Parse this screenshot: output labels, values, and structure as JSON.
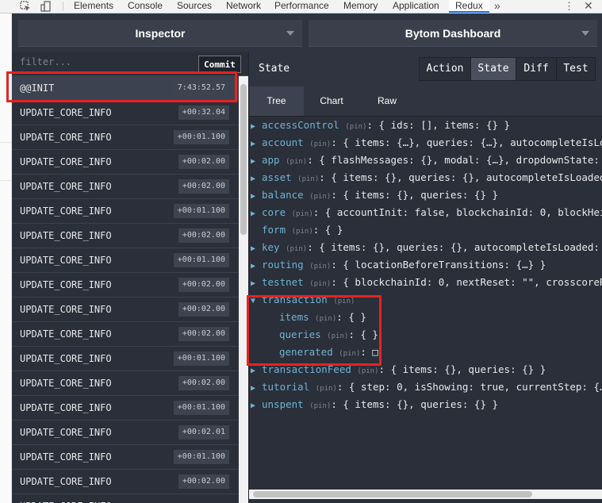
{
  "devtools": {
    "tabs": [
      "Elements",
      "Console",
      "Sources",
      "Network",
      "Performance",
      "Memory",
      "Application",
      "Redux"
    ],
    "active_tab": "Redux",
    "more_label": "»",
    "menu_label": "⋮",
    "close_label": "✕"
  },
  "monitor": {
    "left_select": "Inspector",
    "right_select": "Bytom Dashboard"
  },
  "actions": {
    "filter_placeholder": "filter...",
    "commit_label": "Commit",
    "items": [
      {
        "name": "@@INIT",
        "time": "7:43:52.57"
      },
      {
        "name": "UPDATE_CORE_INFO",
        "time": "+00:32.04"
      },
      {
        "name": "UPDATE_CORE_INFO",
        "time": "+00:01.100"
      },
      {
        "name": "UPDATE_CORE_INFO",
        "time": "+00:02.00"
      },
      {
        "name": "UPDATE_CORE_INFO",
        "time": "+00:02.00"
      },
      {
        "name": "UPDATE_CORE_INFO",
        "time": "+00:01.100"
      },
      {
        "name": "UPDATE_CORE_INFO",
        "time": "+00:02.00"
      },
      {
        "name": "UPDATE_CORE_INFO",
        "time": "+00:01.100"
      },
      {
        "name": "UPDATE_CORE_INFO",
        "time": "+00:02.00"
      },
      {
        "name": "UPDATE_CORE_INFO",
        "time": "+00:02.00"
      },
      {
        "name": "UPDATE_CORE_INFO",
        "time": "+00:02.00"
      },
      {
        "name": "UPDATE_CORE_INFO",
        "time": "+00:01.100"
      },
      {
        "name": "UPDATE_CORE_INFO",
        "time": "+00:02.00"
      },
      {
        "name": "UPDATE_CORE_INFO",
        "time": "+00:01.100"
      },
      {
        "name": "UPDATE_CORE_INFO",
        "time": "+00:02.01"
      },
      {
        "name": "UPDATE_CORE_INFO",
        "time": "+00:01.100"
      },
      {
        "name": "UPDATE_CORE_INFO",
        "time": "+00:02.00"
      },
      {
        "name": "UPDATE_CORE_INFO",
        "time": ""
      }
    ]
  },
  "state": {
    "title": "State",
    "buttons": [
      "Action",
      "State",
      "Diff",
      "Test"
    ],
    "active_button": "State",
    "tabs": [
      "Tree",
      "Chart",
      "Raw"
    ],
    "active_tab": "Tree",
    "tree": [
      {
        "arrow": "▶",
        "key": "accessControl",
        "pin": "(pin)",
        "value": ": { ids: [], items: {} }"
      },
      {
        "arrow": "▶",
        "key": "account",
        "pin": "(pin)",
        "value": ": { items: {…}, queries: {…}, autocompleteIsLoaded"
      },
      {
        "arrow": "▶",
        "key": "app",
        "pin": "(pin)",
        "value": ": { flashMessages: {}, modal: {…}, dropdownState: \"\","
      },
      {
        "arrow": "▶",
        "key": "asset",
        "pin": "(pin)",
        "value": ": { items: {}, queries: {}, autocompleteIsLoaded: f"
      },
      {
        "arrow": "▶",
        "key": "balance",
        "pin": "(pin)",
        "value": ": { items: {}, queries: {} }"
      },
      {
        "arrow": "▶",
        "key": "core",
        "pin": "(pin)",
        "value": ": { accountInit: false, blockchainId: 0, blockHeight"
      },
      {
        "arrow": "",
        "key": "form",
        "pin": "(pin)",
        "value": ": { }"
      },
      {
        "arrow": "▶",
        "key": "key",
        "pin": "(pin)",
        "value": ": { items: {}, queries: {}, autocompleteIsLoaded: fal"
      },
      {
        "arrow": "▶",
        "key": "routing",
        "pin": "(pin)",
        "value": ": { locationBeforeTransitions: {…} }"
      },
      {
        "arrow": "▶",
        "key": "testnet",
        "pin": "(pin)",
        "value": ": { blockchainId: 0, nextReset: \"\", crosscoreRpcV"
      },
      {
        "arrow": "▼",
        "key": "transaction",
        "pin": "(pin)",
        "value": ""
      },
      {
        "arrow": "",
        "key": "items",
        "pin": "(pin)",
        "value": ": { }",
        "indent": 1
      },
      {
        "arrow": "",
        "key": "queries",
        "pin": "(pin)",
        "value": ": { }",
        "indent": 1
      },
      {
        "arrow": "",
        "key": "generated",
        "pin": "(pin)",
        "value": ": □",
        "indent": 1
      },
      {
        "arrow": "▶",
        "key": "transactionFeed",
        "pin": "(pin)",
        "value": ": { items: {}, queries: {} }"
      },
      {
        "arrow": "▶",
        "key": "tutorial",
        "pin": "(pin)",
        "value": ": { step: 0, isShowing: true, currentStep: {…},"
      },
      {
        "arrow": "▶",
        "key": "unspent",
        "pin": "(pin)",
        "value": ": { items: {}, queries: {} }"
      }
    ]
  },
  "colors": {
    "panel_bg": "#2a2f3a",
    "key_blue": "#6fb3d2",
    "highlight_red": "#e52323"
  }
}
